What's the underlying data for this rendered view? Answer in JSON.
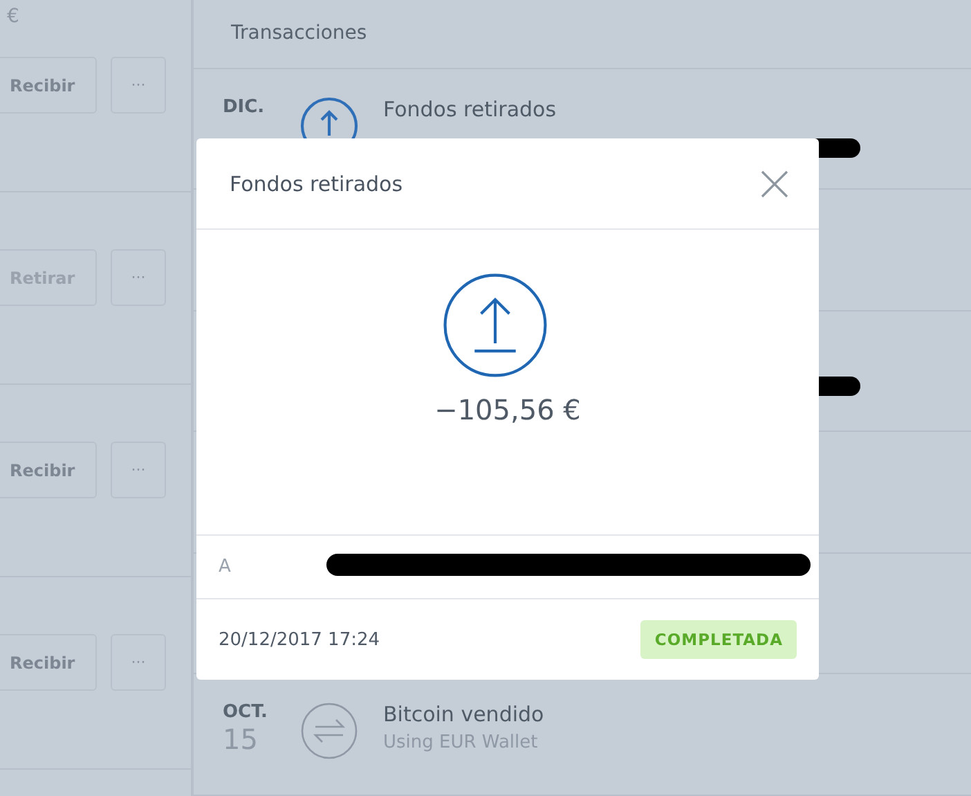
{
  "wallets": [
    {
      "currency": "€",
      "action": {
        "label": "Recibir",
        "disabled": false
      },
      "more": "···"
    },
    {
      "action": {
        "label": "Retirar",
        "disabled": true
      },
      "more": "···"
    },
    {
      "action": {
        "label": "Recibir",
        "disabled": false
      },
      "more": "···"
    },
    {
      "action": {
        "label": "Recibir",
        "disabled": false
      },
      "more": "···"
    }
  ],
  "transactions": {
    "header": "Transacciones",
    "rows": [
      {
        "kind": "withdraw",
        "month": "DIC.",
        "title": "Fondos retirados",
        "redacted": true
      },
      {
        "kind": "hidden",
        "redacted": false
      },
      {
        "kind": "hidden",
        "redacted": true
      },
      {
        "kind": "hidden",
        "redacted": false
      },
      {
        "kind": "hidden",
        "redacted": false
      },
      {
        "kind": "exchange",
        "month": "OCT.",
        "day": "15",
        "title": "Bitcoin vendido",
        "subtitle": "Using EUR Wallet"
      }
    ]
  },
  "modal": {
    "title": "Fondos retirados",
    "kind": "withdraw",
    "amount": "−105,56 €",
    "recipient_label": "A",
    "recipient_redacted": true,
    "date": "20/12/2017 17:24",
    "status": {
      "label": "COMPLETADA",
      "kind": "completed"
    }
  }
}
